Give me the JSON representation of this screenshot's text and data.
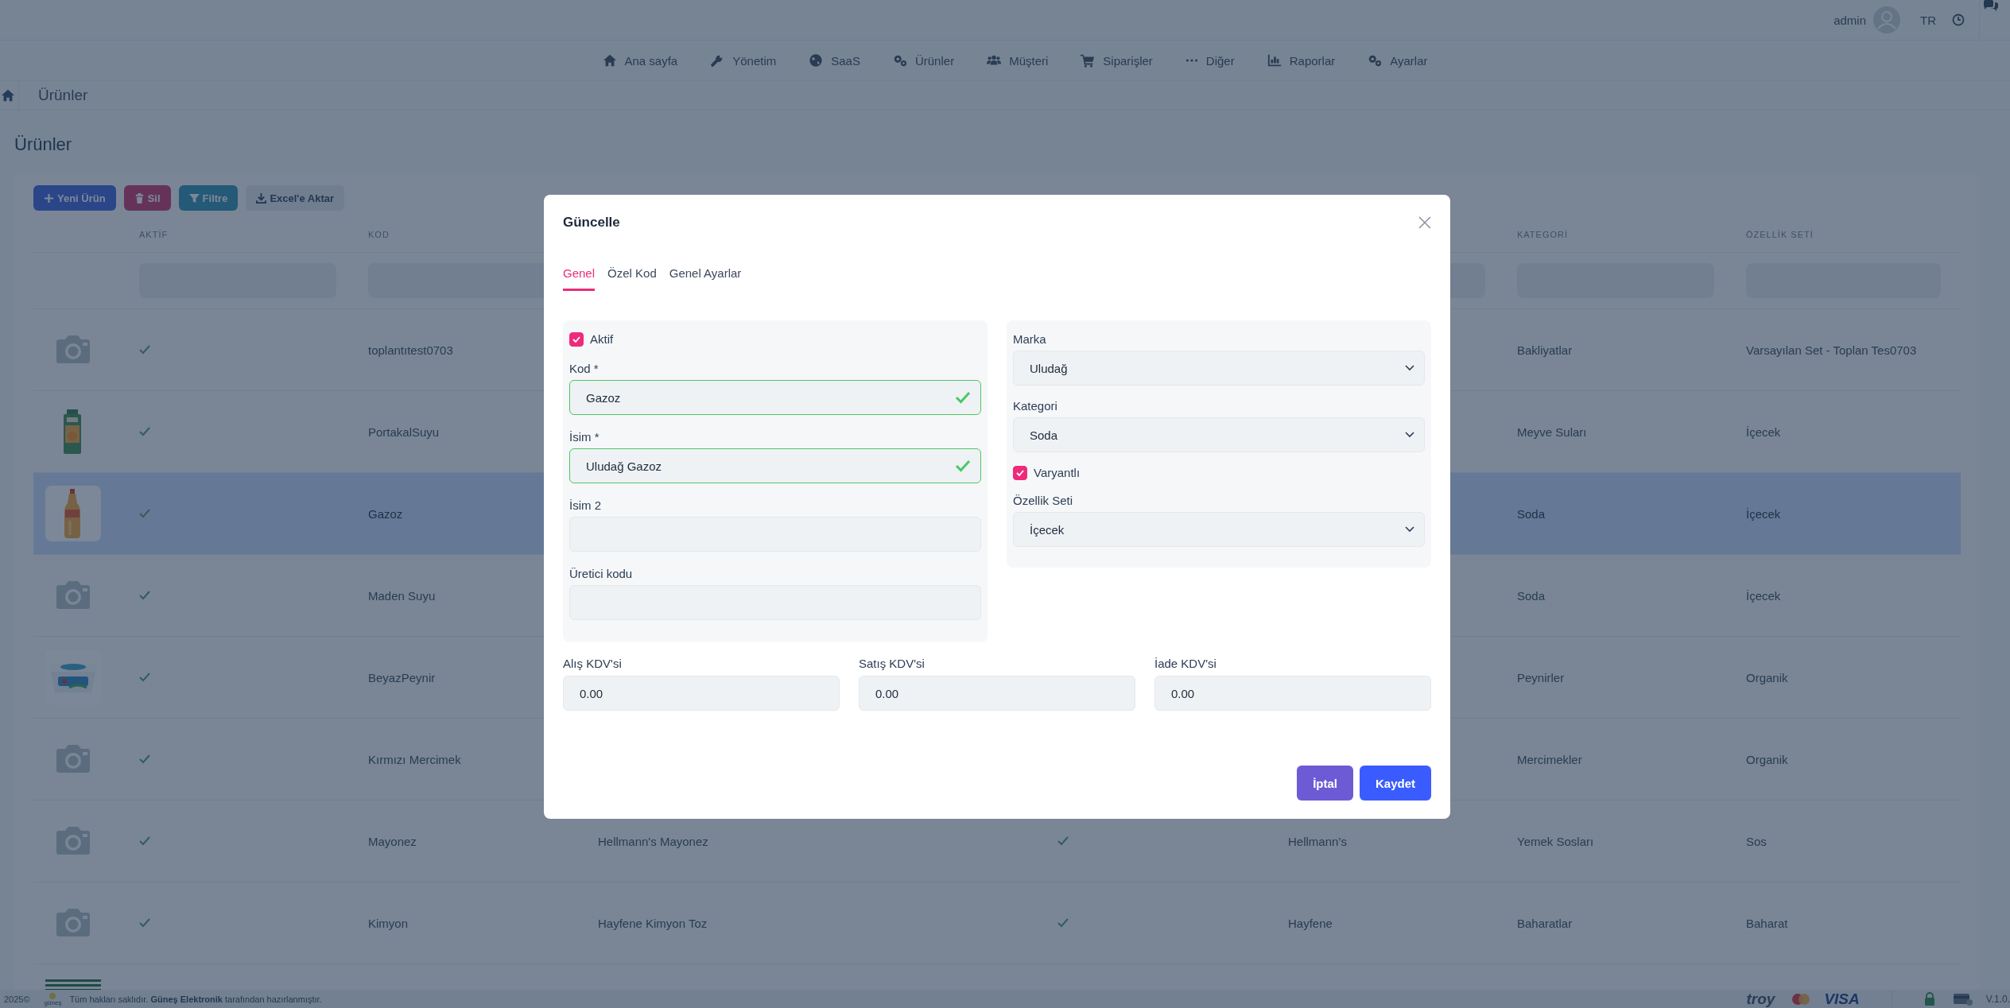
{
  "topbar": {
    "user": "admin",
    "language": "TR"
  },
  "nav": [
    {
      "label": "Ana sayfa"
    },
    {
      "label": "Yönetim"
    },
    {
      "label": "SaaS"
    },
    {
      "label": "Ürünler"
    },
    {
      "label": "Müşteri"
    },
    {
      "label": "Siparişler"
    },
    {
      "label": "Diğer"
    },
    {
      "label": "Raporlar"
    },
    {
      "label": "Ayarlar"
    }
  ],
  "breadcrumb": "Ürünler",
  "page_title": "Ürünler",
  "toolbar": [
    {
      "label": "Yeni Ürün",
      "kind": "primary"
    },
    {
      "label": "Sil",
      "kind": "danger"
    },
    {
      "label": "Filtre",
      "kind": "info"
    },
    {
      "label": "Excel'e Aktar",
      "kind": "light"
    }
  ],
  "table": {
    "columns": {
      "aktif": "AKTİF",
      "kod": "KOD",
      "kategori": "KATEGORİ",
      "ozellik_seti": "ÖZELLİK SETİ"
    },
    "rows": [
      {
        "kind": "placeholder",
        "aktif": true,
        "kod": "toplantıtest0703",
        "kategori": "Bakliyatlar",
        "ozellik_seti": "Varsayılan Set - Toplan Tes0703",
        "selected": false
      },
      {
        "kind": "picture",
        "aktif": true,
        "kod": "PortakalSuyu",
        "kategori": "Meyve Suları",
        "ozellik_seti": "İçecek",
        "selected": false
      },
      {
        "kind": "picture",
        "aktif": true,
        "kod": "Gazoz",
        "kategori": "Soda",
        "ozellik_seti": "İçecek",
        "selected": true
      },
      {
        "kind": "placeholder",
        "aktif": true,
        "kod": "Maden Suyu",
        "kategori": "Soda",
        "ozellik_seti": "İçecek",
        "selected": false
      },
      {
        "kind": "picture",
        "aktif": true,
        "kod": "BeyazPeynir",
        "kategori": "Peynirler",
        "ozellik_seti": "Organik",
        "selected": false
      },
      {
        "kind": "placeholder",
        "aktif": true,
        "kod": "Kırmızı Mercimek",
        "kategori": "Mercimekler",
        "ozellik_seti": "Organik",
        "selected": false
      },
      {
        "kind": "placeholder",
        "aktif": true,
        "kod": "Mayonez",
        "column_4": "Hellmann's Mayonez",
        "column_5": true,
        "column_6": "Hellmann’s",
        "kategori": "Yemek Sosları",
        "ozellik_seti": "Sos",
        "selected": false
      },
      {
        "kind": "placeholder",
        "aktif": true,
        "kod": "Kimyon",
        "column_4": "Hayfene Kimyon Toz",
        "column_5": true,
        "column_6": "Hayfene",
        "kategori": "Baharatlar",
        "ozellik_seti": "Baharat",
        "selected": false
      },
      {
        "kind": "picture",
        "selected": false
      }
    ]
  },
  "modal": {
    "title": "Güncelle",
    "tabs": [
      {
        "label": "Genel",
        "selected": true
      },
      {
        "label": "Özel Kod",
        "selected": false
      },
      {
        "label": "Genel Ayarlar",
        "selected": false
      }
    ],
    "left_fields": [
      {
        "kind": "checkbox",
        "label": "Aktif",
        "checked": true
      },
      {
        "kind": "input",
        "label": "Kod *",
        "value": "Gazoz",
        "valid": true
      },
      {
        "kind": "input",
        "label": "İsim *",
        "value": "Uludağ Gazoz",
        "valid": true
      },
      {
        "kind": "input",
        "label": "İsim 2",
        "valid": false
      },
      {
        "kind": "input",
        "label": "Üretici kodu",
        "valid": false
      }
    ],
    "right_fields": [
      {
        "kind": "select",
        "label": "Marka",
        "value": "Uludağ"
      },
      {
        "kind": "select",
        "label": "Kategori",
        "value": "Soda"
      },
      {
        "kind": "checkbox",
        "label": "Varyantlı",
        "checked": true
      },
      {
        "kind": "select",
        "label": "Özellik Seti",
        "value": "İçecek"
      }
    ],
    "tax_fields": [
      {
        "label": "Alış KDV'si",
        "value": "0.00"
      },
      {
        "label": "Satış KDV'si",
        "value": "0.00"
      },
      {
        "label": "İade KDV'si",
        "value": "0.00"
      }
    ],
    "buttons": [
      {
        "label": "İptal",
        "kind": "secondary"
      },
      {
        "label": "Kaydet",
        "kind": "primary"
      }
    ]
  },
  "footer": {
    "year": "2025©",
    "brand_logo": "güneş",
    "text": "Tüm hakları saklıdır. **Güneş Elektronik** tarafından hazırlanmıştır.",
    "payment_logos": [
      "troy",
      "VISA"
    ],
    "version": "V.1.0."
  }
}
